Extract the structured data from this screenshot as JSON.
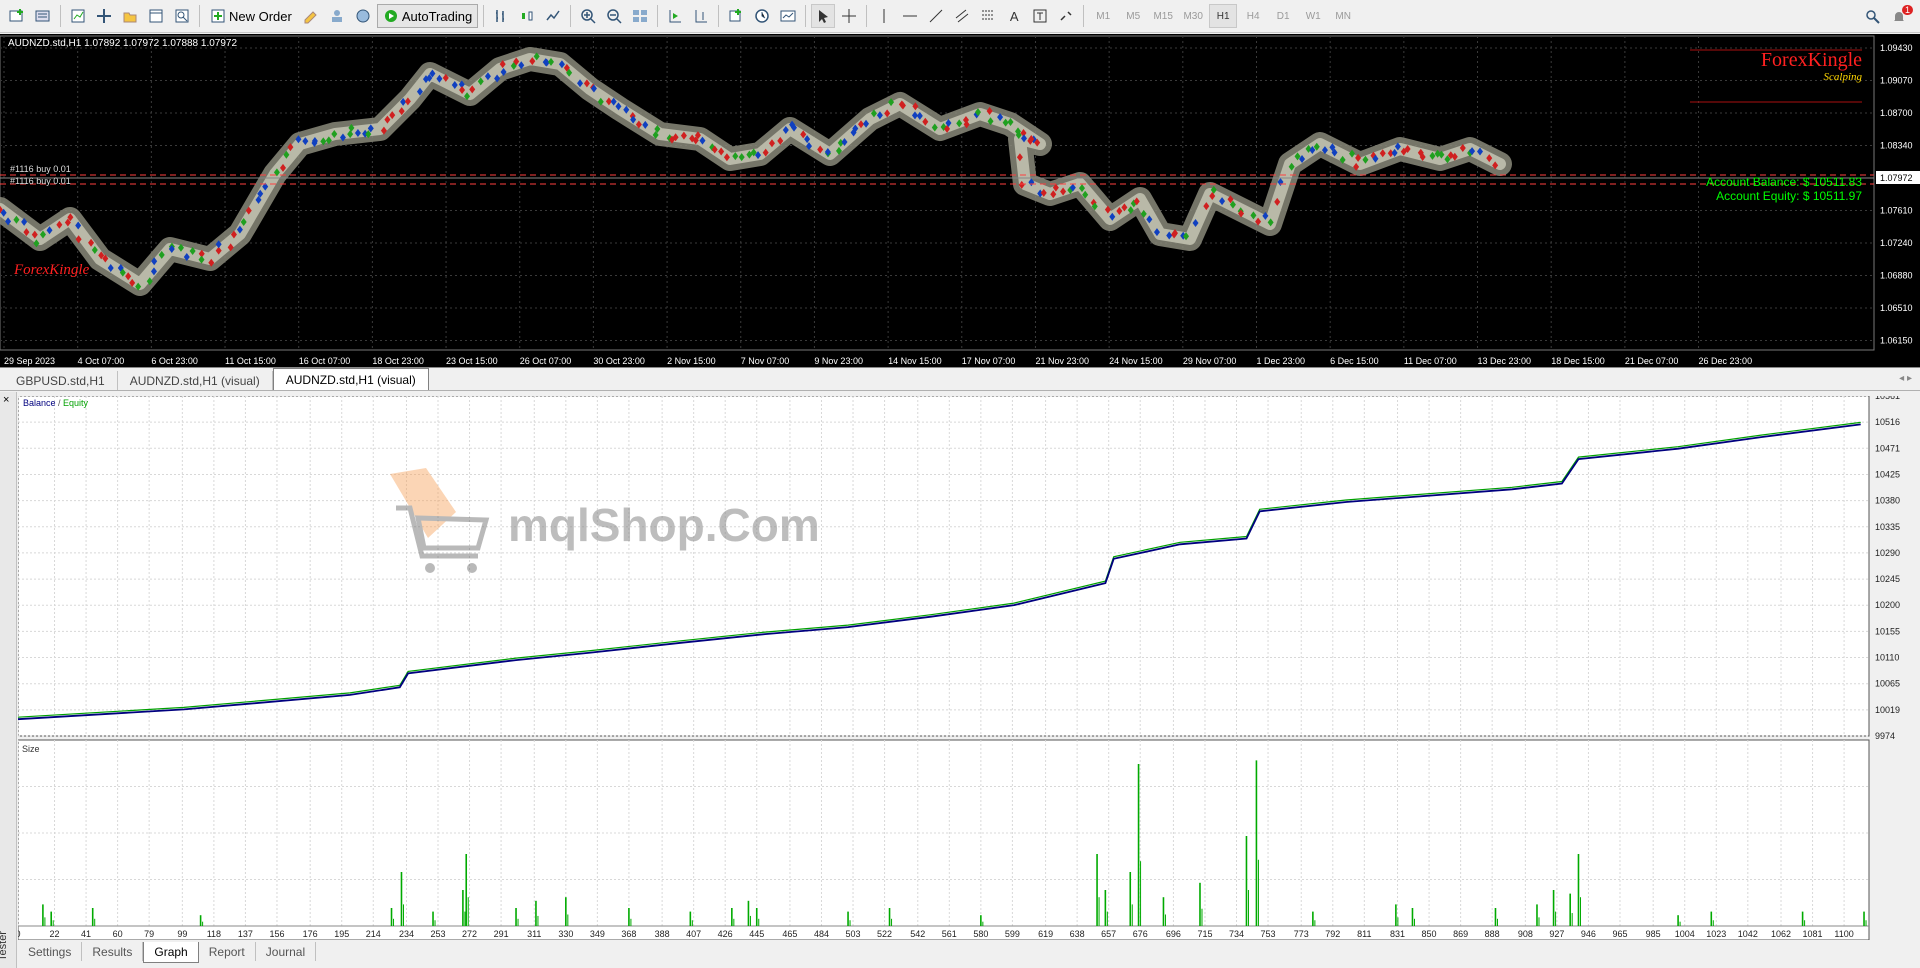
{
  "toolbar": {
    "new_order_label": "New Order",
    "auto_trading_label": "AutoTrading",
    "timeframes": [
      "M1",
      "M5",
      "M15",
      "M30",
      "H1",
      "H4",
      "D1",
      "W1",
      "MN"
    ],
    "active_timeframe": "H1",
    "notification_count": "1"
  },
  "chart": {
    "header": "AUDNZD.std,H1  1.07892 1.07972 1.07888 1.07972",
    "current_price": "1.07972",
    "order_labels": [
      "#1116 buy 0.01",
      "#1116 buy 0.01"
    ],
    "logo_text": "ForexKingle",
    "logo_sub": "Scalping",
    "logo_left": "ForexKingle",
    "account_balance": "Account Balance: $ 10511.83",
    "account_equity": "Account Equity: $ 10511.97",
    "price_levels": [
      "1.09430",
      "1.09070",
      "1.08700",
      "1.08340",
      "1.07972",
      "1.07610",
      "1.07240",
      "1.06880",
      "1.06510",
      "1.06150"
    ],
    "time_labels": [
      "29 Sep 2023",
      "4 Oct 07:00",
      "6 Oct 23:00",
      "11 Oct 15:00",
      "16 Oct 07:00",
      "18 Oct 23:00",
      "23 Oct 15:00",
      "26 Oct 07:00",
      "30 Oct 23:00",
      "2 Nov 15:00",
      "7 Nov 07:00",
      "9 Nov 23:00",
      "14 Nov 15:00",
      "17 Nov 07:00",
      "21 Nov 23:00",
      "24 Nov 15:00",
      "29 Nov 07:00",
      "1 Dec 23:00",
      "6 Dec 15:00",
      "11 Dec 07:00",
      "13 Dec 23:00",
      "18 Dec 15:00",
      "21 Dec 07:00",
      "26 Dec 23:00"
    ],
    "colors": {
      "background": "#000000",
      "grid": "#3a3a3a",
      "axis_text": "#ffffff",
      "balance_text": "#00ff00",
      "logo": "#ff2020",
      "price_line": "#ff4040"
    }
  },
  "chart_tabs": [
    {
      "label": "GBPUSD.std,H1",
      "active": false
    },
    {
      "label": "AUDNZD.std,H1 (visual)",
      "active": false
    },
    {
      "label": "AUDNZD.std,H1 (visual)",
      "active": true
    }
  ],
  "tester": {
    "close_label": "×",
    "side_label": "Tester",
    "watermark": "mqlShop.Com",
    "tabs": [
      {
        "label": "Settings",
        "active": false
      },
      {
        "label": "Results",
        "active": false
      },
      {
        "label": "Graph",
        "active": true
      },
      {
        "label": "Report",
        "active": false
      },
      {
        "label": "Journal",
        "active": false
      }
    ]
  },
  "chart_data": [
    {
      "type": "line",
      "legend_balance": "Balance",
      "legend_sep": " / ",
      "legend_equity": "Equity",
      "series": [
        {
          "name": "Balance",
          "color": "#00007f"
        },
        {
          "name": "Equity",
          "color": "#00a000"
        }
      ],
      "x": [
        0,
        100,
        200,
        230,
        235,
        300,
        345,
        400,
        450,
        500,
        550,
        600,
        655,
        660,
        700,
        740,
        748,
        800,
        900,
        930,
        940,
        1000,
        1050,
        1110
      ],
      "y": [
        10003,
        10020,
        10045,
        10058,
        10082,
        10105,
        10118,
        10135,
        10150,
        10162,
        10180,
        10200,
        10238,
        10280,
        10305,
        10315,
        10362,
        10378,
        10400,
        10410,
        10452,
        10470,
        10490,
        10512
      ],
      "ylim": [
        9974,
        10561
      ],
      "y_ticks": [
        "10561",
        "10516",
        "10471",
        "10425",
        "10380",
        "10335",
        "10290",
        "10245",
        "10200",
        "10155",
        "10110",
        "10065",
        "10019",
        "9974"
      ],
      "xlim": [
        0,
        1115
      ],
      "grid": true
    },
    {
      "type": "bar",
      "title": "Size",
      "color": "#00aa00",
      "x_ticks": [
        "0",
        "22",
        "41",
        "60",
        "79",
        "99",
        "118",
        "137",
        "156",
        "176",
        "195",
        "214",
        "234",
        "253",
        "272",
        "291",
        "311",
        "330",
        "349",
        "368",
        "388",
        "407",
        "426",
        "445",
        "465",
        "484",
        "503",
        "522",
        "542",
        "561",
        "580",
        "599",
        "619",
        "638",
        "657",
        "676",
        "696",
        "715",
        "734",
        "753",
        "773",
        "792",
        "811",
        "831",
        "850",
        "869",
        "888",
        "908",
        "927",
        "946",
        "965",
        "985",
        "1004",
        "1023",
        "1042",
        "1062",
        "1081",
        "1100"
      ],
      "spikes": [
        {
          "x": 15,
          "v": 0.12
        },
        {
          "x": 20,
          "v": 0.08
        },
        {
          "x": 45,
          "v": 0.1
        },
        {
          "x": 110,
          "v": 0.06
        },
        {
          "x": 225,
          "v": 0.1
        },
        {
          "x": 231,
          "v": 0.3
        },
        {
          "x": 250,
          "v": 0.08
        },
        {
          "x": 268,
          "v": 0.2
        },
        {
          "x": 270,
          "v": 0.4
        },
        {
          "x": 300,
          "v": 0.1
        },
        {
          "x": 312,
          "v": 0.14
        },
        {
          "x": 330,
          "v": 0.16
        },
        {
          "x": 368,
          "v": 0.1
        },
        {
          "x": 405,
          "v": 0.08
        },
        {
          "x": 430,
          "v": 0.1
        },
        {
          "x": 440,
          "v": 0.14
        },
        {
          "x": 445,
          "v": 0.1
        },
        {
          "x": 500,
          "v": 0.08
        },
        {
          "x": 525,
          "v": 0.1
        },
        {
          "x": 580,
          "v": 0.06
        },
        {
          "x": 650,
          "v": 0.4
        },
        {
          "x": 655,
          "v": 0.2
        },
        {
          "x": 670,
          "v": 0.3
        },
        {
          "x": 675,
          "v": 0.9
        },
        {
          "x": 690,
          "v": 0.16
        },
        {
          "x": 712,
          "v": 0.24
        },
        {
          "x": 740,
          "v": 0.5
        },
        {
          "x": 746,
          "v": 0.92
        },
        {
          "x": 780,
          "v": 0.08
        },
        {
          "x": 830,
          "v": 0.12
        },
        {
          "x": 840,
          "v": 0.1
        },
        {
          "x": 890,
          "v": 0.1
        },
        {
          "x": 915,
          "v": 0.12
        },
        {
          "x": 925,
          "v": 0.2
        },
        {
          "x": 935,
          "v": 0.18
        },
        {
          "x": 940,
          "v": 0.4
        },
        {
          "x": 1000,
          "v": 0.06
        },
        {
          "x": 1020,
          "v": 0.08
        },
        {
          "x": 1075,
          "v": 0.08
        },
        {
          "x": 1112,
          "v": 0.08
        }
      ]
    }
  ]
}
